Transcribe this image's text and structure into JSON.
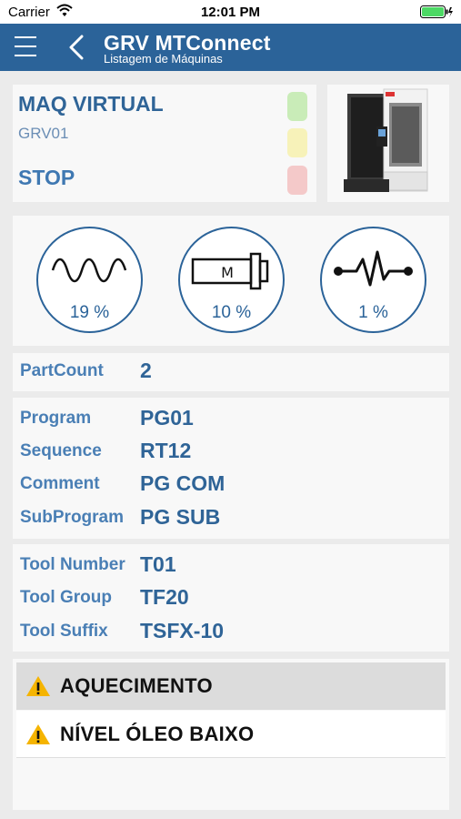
{
  "status_bar": {
    "carrier": "Carrier",
    "time": "12:01 PM"
  },
  "nav": {
    "title": "GRV MTConnect",
    "subtitle": "Listagem de Máquinas"
  },
  "machine": {
    "name": "MAQ VIRTUAL",
    "code": "GRV01",
    "state": "STOP",
    "lights": {
      "green": "#c9ecb8",
      "yellow": "#f7f2b9",
      "red": "#f4c9c9"
    }
  },
  "gauges": [
    {
      "icon": "wave-icon",
      "value": "19 %"
    },
    {
      "icon": "spindle-motor-icon",
      "motor_letter": "M",
      "value": "10 %"
    },
    {
      "icon": "pulse-icon",
      "value": "1 %"
    }
  ],
  "partcount": {
    "label": "PartCount",
    "value": "2"
  },
  "program": [
    {
      "label": "Program",
      "value": "PG01"
    },
    {
      "label": "Sequence",
      "value": "RT12"
    },
    {
      "label": "Comment",
      "value": "PG COM"
    },
    {
      "label": "SubProgram",
      "value": "PG SUB"
    }
  ],
  "tool": [
    {
      "label": "Tool Number",
      "value": "T01"
    },
    {
      "label": "Tool Group",
      "value": "TF20"
    },
    {
      "label": "Tool Suffix",
      "value": "TSFX-10"
    }
  ],
  "alarms": [
    {
      "icon": "warning-icon",
      "text": "AQUECIMENTO"
    },
    {
      "icon": "warning-icon",
      "text": "NÍVEL ÓLEO BAIXO"
    }
  ],
  "colors": {
    "primary": "#2b6399",
    "background": "#ebebeb",
    "card": "#f8f8f8",
    "warning": "#f5b400"
  }
}
